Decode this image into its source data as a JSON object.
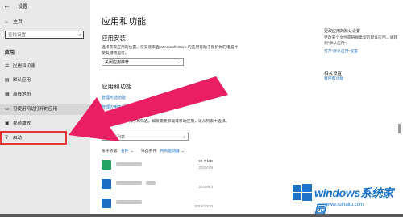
{
  "sidebar": {
    "back_glyph": "←",
    "window_title": "设置",
    "home_label": "主页",
    "search_placeholder": "查找设置",
    "section_title": "应用",
    "items": [
      {
        "label": "应用和功能",
        "icon": "app-list-icon"
      },
      {
        "label": "默认应用",
        "icon": "default-apps-icon"
      },
      {
        "label": "离线地图",
        "icon": "offline-maps-icon"
      },
      {
        "label": "可使用网站打开的应用",
        "icon": "apps-for-websites-icon"
      },
      {
        "label": "视频播放",
        "icon": "video-playback-icon"
      },
      {
        "label": "启动",
        "icon": "startup-icon"
      }
    ]
  },
  "main": {
    "title": "应用和功能",
    "install_section": {
      "title": "应用安装",
      "description": "选择获取应用的位置。仅安装来自 Microsoft Store 的应用有助于保护你的电脑并使其顺畅运行。",
      "dropdown_value": "关闭应用推荐"
    },
    "features_section": {
      "title": "应用和功能",
      "link1": "管理可选功能",
      "link2": "管理应用执行别名",
      "description": "按驱动器搜索、排序和筛选。如果需要卸载或移动应用，请从列表中选择。",
      "search_placeholder": "搜索此列表",
      "sort_label": "排序依据:",
      "sort_value": "名称",
      "filter_label": "筛选条件:",
      "filter_value": "所有驱动器"
    },
    "apps": [
      {
        "size": "20.7 MB",
        "date": "2020/1/9"
      },
      {
        "size": "",
        "date": "2019/9/3"
      },
      {
        "size": "",
        "date": "2019/10/10"
      }
    ]
  },
  "right_panel": {
    "block1_title": "更改应用的默认设置",
    "block1_text": "更改某个文件或链接类型的默认应用，请转到\"默认应用\"。",
    "block1_link": "打开\"默认应用\"设置",
    "related_title": "相关设置",
    "related_link": "程序和功能"
  },
  "watermark": {
    "title": "windows系统家园",
    "url": "www.ruihaitu.com"
  },
  "colors": {
    "sidebar_bg": "#e9e9e9",
    "link": "#1a6fc4",
    "highlight_box": "#e53935",
    "arrow": "#e91e63"
  }
}
